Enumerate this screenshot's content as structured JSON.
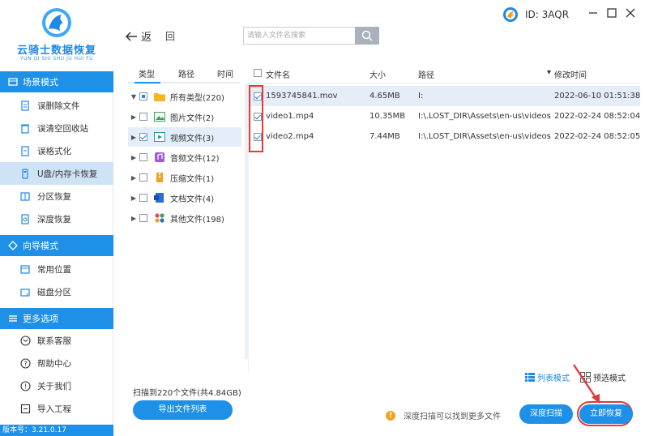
{
  "app": {
    "name": "云骑士数据恢复",
    "name_sub": "YUN QI SHI SHU JU HUI FU",
    "user_id": "ID: 3AQR",
    "version": "版本号：3.21.0.17"
  },
  "sidebar": {
    "sections": [
      {
        "title": "场景模式",
        "items": [
          {
            "label": "误删除文件",
            "icon": "trash-file-icon"
          },
          {
            "label": "误清空回收站",
            "icon": "recycle-bin-icon"
          },
          {
            "label": "误格式化",
            "icon": "format-icon"
          },
          {
            "label": "U盘/内存卡恢复",
            "icon": "usb-drive-icon"
          },
          {
            "label": "分区恢复",
            "icon": "partition-icon"
          },
          {
            "label": "深度恢复",
            "icon": "deep-recovery-icon"
          }
        ]
      },
      {
        "title": "向导模式",
        "items": [
          {
            "label": "常用位置",
            "icon": "location-icon"
          },
          {
            "label": "磁盘分区",
            "icon": "disk-icon"
          }
        ]
      },
      {
        "title": "更多选项",
        "items": [
          {
            "label": "联系客服",
            "icon": "support-icon"
          },
          {
            "label": "帮助中心",
            "icon": "help-icon"
          },
          {
            "label": "关于我们",
            "icon": "info-icon"
          },
          {
            "label": "导入工程",
            "icon": "import-icon"
          }
        ]
      }
    ],
    "active_item": "U盘/内存卡恢复"
  },
  "toolbar": {
    "back_label": "返",
    "return_label": "回",
    "search_placeholder": "请输入文件名搜索"
  },
  "tree": {
    "headers": [
      "类型",
      "路径",
      "时间"
    ],
    "active_header": "类型",
    "root": {
      "label": "所有类型(220)",
      "state": "partial"
    },
    "items": [
      {
        "label": "图片文件(2)",
        "icon": "image-file-icon",
        "checked": false
      },
      {
        "label": "视频文件(3)",
        "icon": "video-file-icon",
        "checked": true
      },
      {
        "label": "音频文件(12)",
        "icon": "audio-file-icon",
        "checked": false
      },
      {
        "label": "压缩文件(1)",
        "icon": "archive-file-icon",
        "checked": false
      },
      {
        "label": "文档文件(4)",
        "icon": "document-file-icon",
        "checked": false
      },
      {
        "label": "其他文件(198)",
        "icon": "other-file-icon",
        "checked": false
      }
    ]
  },
  "file_list": {
    "columns": {
      "name": "文件名",
      "size": "大小",
      "path": "路径",
      "modified": "修改时间",
      "sort_indicator": "▾"
    },
    "rows": [
      {
        "name": "1593745841.mov",
        "size": "4.65MB",
        "path": "I:",
        "modified": "2022-06-10 01:51:38",
        "checked": true
      },
      {
        "name": "video1.mp4",
        "size": "10.35MB",
        "path": "I:\\.LOST_DIR\\Assets\\en-us\\videos",
        "modified": "2022-02-24 08:52:04",
        "checked": true
      },
      {
        "name": "video2.mp4",
        "size": "7.44MB",
        "path": "I:\\.LOST_DIR\\Assets\\en-us\\videos",
        "modified": "2022-02-24 08:52:05",
        "checked": true
      }
    ]
  },
  "bottom": {
    "scan_summary": "扫描到220个文件(共4.84GB)",
    "export_label": "导出文件列表",
    "view_list_label": "列表模式",
    "view_preview_label": "预选模式",
    "tip": "深度扫描可以找到更多文件",
    "deep_scan_label": "深度扫描",
    "recover_label": "立即恢复"
  },
  "colors": {
    "accent": "#1e90e8",
    "highlight": "#e53935",
    "selected_row": "#e5eef8"
  }
}
